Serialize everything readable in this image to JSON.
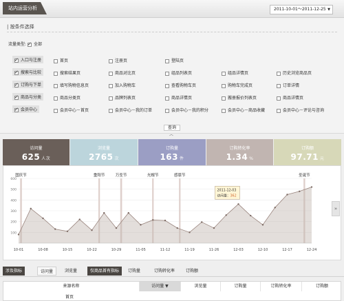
{
  "header": {
    "tab_label": "站内运营分析",
    "date_range": "2011-10-01～2011-12-25"
  },
  "filter": {
    "title": "| 按条件选择",
    "flow_type_label": "流量类型:",
    "all_label": "全部",
    "rows": [
      {
        "items": [
          "入口与注册",
          "首页",
          "注册页",
          "登陆页"
        ],
        "checked": [
          true,
          false,
          false,
          false
        ]
      },
      {
        "items": [
          "搜索与比较",
          "搜索结果页",
          "商品对比页",
          "组品列表页",
          "组品详情页",
          "历史浏览商品页"
        ],
        "checked": [
          true,
          false,
          false,
          false,
          false,
          false
        ]
      },
      {
        "items": [
          "订购与下单",
          "填写购物信息页",
          "加入购物车",
          "查看购物车页",
          "购物车完成页",
          "订单详情"
        ],
        "checked": [
          true,
          false,
          false,
          false,
          false,
          false
        ]
      },
      {
        "items": [
          "商品与分类",
          "商品分类页",
          "品牌列表页",
          "商品详情页",
          "搬册报价列表页",
          "商品详情页"
        ],
        "checked": [
          true,
          false,
          false,
          false,
          false,
          false
        ]
      },
      {
        "items": [
          "会员中心",
          "会员中心－首页",
          "会员中心－我的订单",
          "会员中心－我的积分",
          "会员中心－商品收藏",
          "会员中心－评论与咨询"
        ],
        "checked": [
          true,
          false,
          false,
          false,
          false,
          false
        ]
      }
    ],
    "query_label": "查询",
    "collapse_icon": "chevron-up-icon"
  },
  "metrics": [
    {
      "label": "访问量",
      "value": "625",
      "unit": "人次",
      "color": "#6a5f59"
    },
    {
      "label": "浏览量",
      "value": "2765",
      "unit": "次",
      "color": "#bcd5dc"
    },
    {
      "label": "订购量",
      "value": "163",
      "unit": "件",
      "color": "#9b9ec4"
    },
    {
      "label": "订购转化率",
      "value": "1.34",
      "unit": "%",
      "color": "#c1b5b1"
    },
    {
      "label": "订购额",
      "value": "97.71",
      "unit": "元",
      "color": "#d7d8b8"
    }
  ],
  "chart_data": {
    "type": "area",
    "x": [
      "10-01",
      "10-08",
      "10-15",
      "10-22",
      "10-29",
      "11-05",
      "11-12",
      "11-19",
      "11-26",
      "12-03",
      "12-10",
      "12-17",
      "12-24"
    ],
    "yticks": [
      "600",
      "500",
      "400",
      "300",
      "200",
      "100"
    ],
    "ylim": [
      0,
      600
    ],
    "series": [
      {
        "name": "访问量",
        "color": "#c2b5b0",
        "points": [
          [
            0,
            80
          ],
          [
            0.5,
            320
          ],
          [
            1,
            230
          ],
          [
            1.5,
            130
          ],
          [
            2,
            110
          ],
          [
            2.5,
            220
          ],
          [
            3,
            120
          ],
          [
            3.5,
            280
          ],
          [
            4,
            140
          ],
          [
            4.5,
            280
          ],
          [
            5,
            170
          ],
          [
            5.5,
            215
          ],
          [
            6,
            210
          ],
          [
            6.5,
            140
          ],
          [
            7,
            100
          ],
          [
            7.5,
            195
          ],
          [
            8,
            140
          ],
          [
            8.5,
            260
          ],
          [
            9,
            362
          ],
          [
            9.5,
            255
          ],
          [
            10,
            170
          ],
          [
            10.5,
            330
          ],
          [
            11,
            450
          ],
          [
            11.5,
            480
          ],
          [
            12,
            520
          ]
        ]
      }
    ],
    "events": [
      "国庆节",
      "重阳节",
      "万圣节",
      "光棍节",
      "感恩节",
      "圣诞节"
    ],
    "tooltip": {
      "date": "2011-12-03",
      "label": "访问量：",
      "value": "362"
    }
  },
  "side_button": "»",
  "tabs": {
    "items": [
      "涉及指标",
      "访问量",
      "浏览量",
      "仅商品首有指标",
      "订购量",
      "订购转化率",
      "订购额"
    ]
  },
  "table": {
    "headers": [
      "来源名称",
      "访问量",
      "浏览量",
      "订购量",
      "订购转化率",
      "订购额"
    ],
    "sort_icon": "sort-down-icon",
    "first_cell": "首页"
  }
}
